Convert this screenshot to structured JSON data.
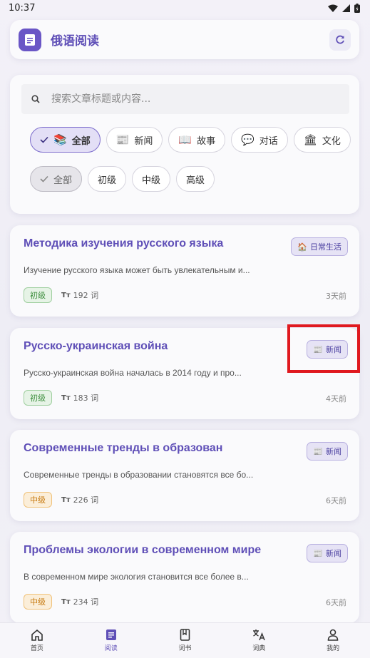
{
  "status": {
    "time": "10:37"
  },
  "header": {
    "title": "俄语阅读",
    "logo_icon": "document-icon",
    "refresh_icon": "refresh-icon"
  },
  "search": {
    "placeholder": "搜索文章标题或内容..."
  },
  "categories": [
    {
      "label": "全部",
      "emoji": "📚",
      "selected": true
    },
    {
      "label": "新闻",
      "emoji": "📰",
      "selected": false
    },
    {
      "label": "故事",
      "emoji": "📖",
      "selected": false
    },
    {
      "label": "对话",
      "emoji": "💬",
      "selected": false
    },
    {
      "label": "文化",
      "emoji": "🏛",
      "selected": false
    }
  ],
  "levels": [
    {
      "label": "全部",
      "selected": true
    },
    {
      "label": "初级",
      "selected": false
    },
    {
      "label": "中级",
      "selected": false
    },
    {
      "label": "高级",
      "selected": false
    }
  ],
  "articles": [
    {
      "title": "Методика изучения русского языка",
      "badge": "日常生活",
      "badge_emoji": "🏠",
      "snippet": "Изучение русского языка может быть увлекательным и...",
      "level": "初级",
      "level_color": "green",
      "words": "192 词",
      "time": "3天前"
    },
    {
      "title": "Русско-украинская война",
      "badge": "新闻",
      "badge_emoji": "📰",
      "snippet": "Русско-украинская война началась в 2014 году и про...",
      "level": "初级",
      "level_color": "green",
      "words": "183 词",
      "time": "4天前"
    },
    {
      "title": "Современные тренды в образован",
      "badge": "新闻",
      "badge_emoji": "📰",
      "snippet": "Современные тренды в образовании становятся все бо...",
      "level": "中级",
      "level_color": "orange",
      "words": "226 词",
      "time": "6天前"
    },
    {
      "title": "Проблемы экологии в современном мире",
      "badge": "新闻",
      "badge_emoji": "📰",
      "snippet": "В современном мире экология становится все более в...",
      "level": "中级",
      "level_color": "orange",
      "words": "234 词",
      "time": "6天前"
    }
  ],
  "nav": [
    {
      "label": "首页",
      "icon": "home-icon",
      "active": false
    },
    {
      "label": "阅读",
      "icon": "reading-icon",
      "active": true
    },
    {
      "label": "词书",
      "icon": "book-icon",
      "active": false
    },
    {
      "label": "词典",
      "icon": "translate-icon",
      "active": false
    },
    {
      "label": "我的",
      "icon": "profile-icon",
      "active": false
    }
  ],
  "colors": {
    "accent": "#6a56c6",
    "highlight": "#e0191f"
  }
}
